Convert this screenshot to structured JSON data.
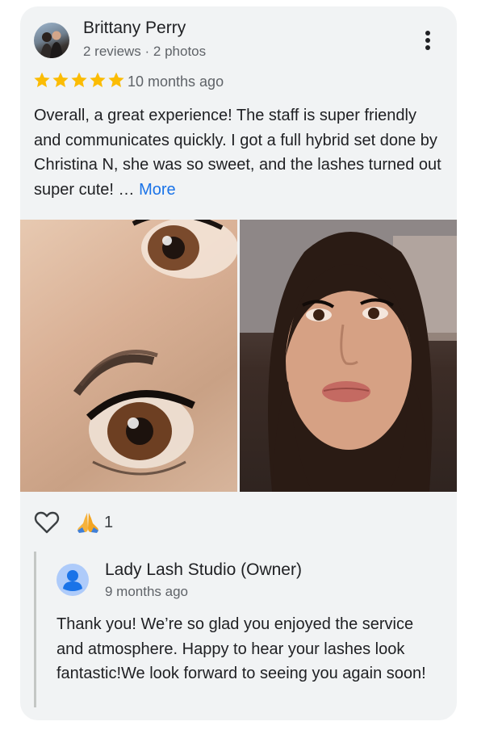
{
  "review": {
    "reviewer_name": "Brittany Perry",
    "reviewer_meta": "2 reviews · 2 photos",
    "rating": 5,
    "time_ago": "10 months ago",
    "text": "Overall, a great experience! The staff is super friendly and communicates quickly. I got a full hybrid set done by Christina N, she was so sweet, and the lashes turned out super cute! … ",
    "more_label": "More",
    "avatar_icon": "user-photo-avatar",
    "menu_icon": "more-vert-icon"
  },
  "photos": [
    {
      "subject": "close-up of eyelash extensions"
    },
    {
      "subject": "selfie of woman with lash extensions"
    }
  ],
  "reactions": {
    "like_icon": "heart-outline-icon",
    "emoji": "🙏",
    "emoji_count": "1"
  },
  "owner_reply": {
    "name": "Lady Lash Studio (Owner)",
    "time_ago": "9 months ago",
    "text": "Thank you! We’re so glad you enjoyed the service and atmosphere. Happy to hear your lashes look fantastic!We look forward to seeing you again soon!",
    "avatar_icon": "person-icon"
  },
  "colors": {
    "card_bg": "#f1f3f4",
    "star": "#fbbc04",
    "link": "#1a73e8",
    "secondary_text": "#5f6368",
    "avatar_blue": "#aecbfa",
    "avatar_person": "#1a73e8"
  }
}
